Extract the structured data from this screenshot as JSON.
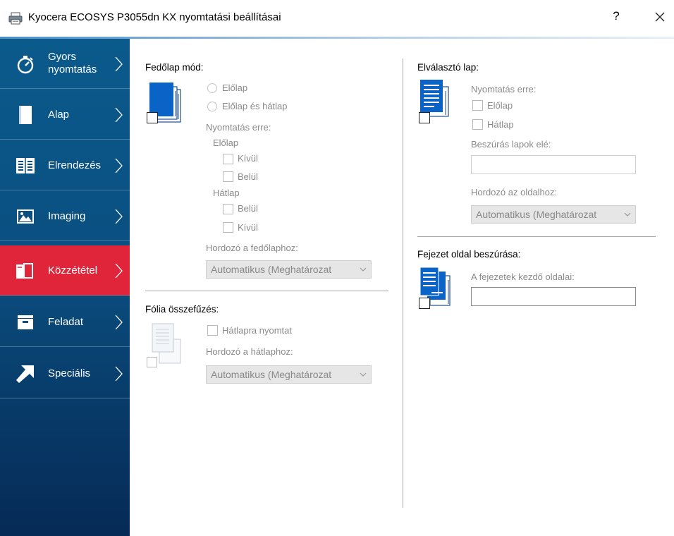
{
  "window": {
    "title": "Kyocera ECOSYS P3055dn KX nyomtatási beállításai",
    "help_glyph": "?"
  },
  "sidebar": {
    "items": [
      {
        "label_line1": "Gyors",
        "label_line2": "nyomtatás",
        "icon": "stopwatch-icon"
      },
      {
        "label": "Alap",
        "icon": "page-icon"
      },
      {
        "label": "Elrendezés",
        "icon": "layout-grid-icon"
      },
      {
        "label": "Imaging",
        "icon": "picture-icon"
      },
      {
        "label": "Közzététel",
        "icon": "publishing-icon",
        "active": true
      },
      {
        "label": "Feladat",
        "icon": "job-tray-icon"
      },
      {
        "label": "Speciális",
        "icon": "arrow-icon"
      }
    ],
    "active_color": "#e0253a"
  },
  "cover": {
    "heading": "Fedőlap mód:",
    "front": "Előlap",
    "front_back": "Előlap és hátlap",
    "print_on": "Nyomtatás erre:",
    "front_group": "Előlap",
    "outside": "Kívül",
    "inside": "Belül",
    "back_group": "Hátlap",
    "back_inside": "Belül",
    "back_outside": "Kívül",
    "media_label": "Hordozó a fedőlaphoz:",
    "media_value": "Automatikus (Meghatározat"
  },
  "transparency": {
    "heading": "Fólia összefűzés:",
    "print_back": "Hátlapra nyomtat",
    "media_label": "Hordozó a hátlaphoz:",
    "media_value": "Automatikus (Meghatározat"
  },
  "separator": {
    "heading": "Elválasztó lap:",
    "print_on": "Nyomtatás erre:",
    "front": "Előlap",
    "back": "Hátlap",
    "insert_before": "Beszúrás lapok elé:",
    "insert_value": "",
    "media_label": "Hordozó az oldalhoz:",
    "media_value": "Automatikus (Meghatározat"
  },
  "chapter": {
    "heading": "Fejezet oldal beszúrása:",
    "start_pages": "A fejezetek kezdő oldalai:",
    "start_value": ""
  }
}
